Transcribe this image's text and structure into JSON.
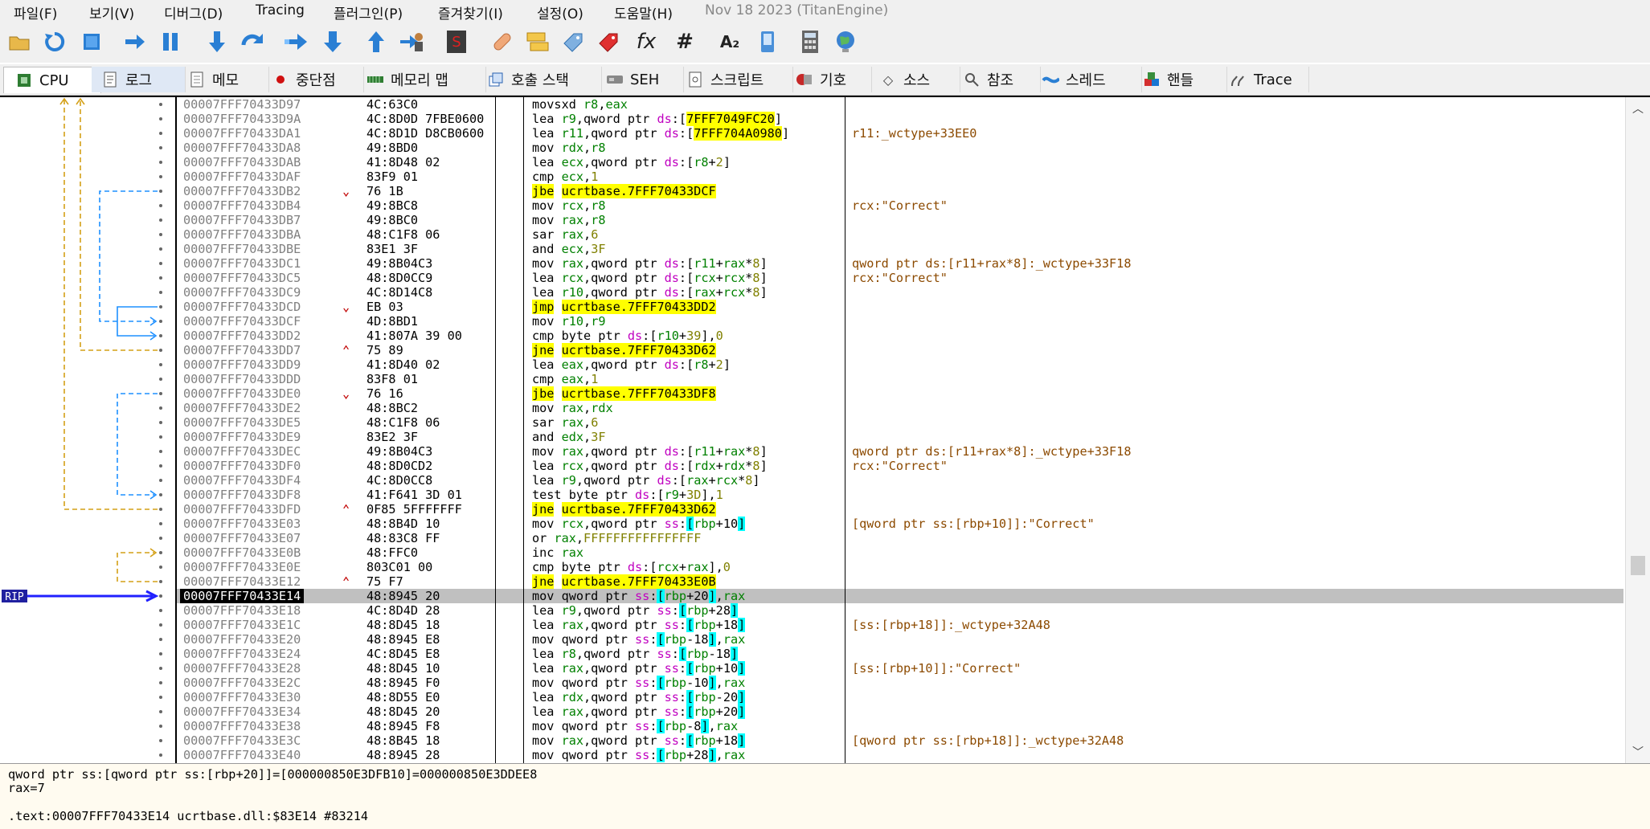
{
  "menu": [
    "파일(F)",
    "보기(V)",
    "디버그(D)",
    "Tracing",
    "플러그인(P)",
    "즐겨찾기(I)",
    "설정(O)",
    "도움말(H)"
  ],
  "build_label": "Nov 18 2023 (TitanEngine)",
  "toolbar": {
    "fx_label": "fx",
    "hash_label": "#",
    "az_label": "A₂"
  },
  "tabs": [
    {
      "label": "CPU",
      "icon": "cpu-icon"
    },
    {
      "label": "로그",
      "icon": "log-icon"
    },
    {
      "label": "메모",
      "icon": "notes-icon"
    },
    {
      "label": "중단점",
      "icon": "breakpoint-icon"
    },
    {
      "label": "메모리 맵",
      "icon": "memory-map-icon"
    },
    {
      "label": "호출 스택",
      "icon": "call-stack-icon"
    },
    {
      "label": "SEH",
      "icon": "seh-icon"
    },
    {
      "label": "스크립트",
      "icon": "script-icon"
    },
    {
      "label": "기호",
      "icon": "symbols-icon"
    },
    {
      "label": "소스",
      "icon": "source-icon"
    },
    {
      "label": "참조",
      "icon": "references-icon"
    },
    {
      "label": "스레드",
      "icon": "threads-icon"
    },
    {
      "label": "핸들",
      "icon": "handles-icon"
    },
    {
      "label": "Trace",
      "icon": "trace-icon"
    }
  ],
  "rip_label": "RIP",
  "disasm": [
    {
      "addr": "00007FFF70433D97",
      "arrow": "",
      "bytes": "4C:63C0",
      "asm": "movsxd r8,eax",
      "comment": ""
    },
    {
      "addr": "00007FFF70433D9A",
      "arrow": "",
      "bytes": "4C:8D0D 7FBE0600",
      "asm": "lea r9,qword ptr ds:[7FFF7049FC20]",
      "comment": ""
    },
    {
      "addr": "00007FFF70433DA1",
      "arrow": "",
      "bytes": "4C:8D1D D8CB0600",
      "asm": "lea r11,qword ptr ds:[7FFF704A0980]",
      "comment": "r11:_wctype+33EE0"
    },
    {
      "addr": "00007FFF70433DA8",
      "arrow": "",
      "bytes": "49:8BD0",
      "asm": "mov rdx,r8",
      "comment": ""
    },
    {
      "addr": "00007FFF70433DAB",
      "arrow": "",
      "bytes": "41:8D48 02",
      "asm": "lea ecx,qword ptr ds:[r8+2]",
      "comment": ""
    },
    {
      "addr": "00007FFF70433DAF",
      "arrow": "",
      "bytes": "83F9 01",
      "asm": "cmp ecx,1",
      "comment": ""
    },
    {
      "addr": "00007FFF70433DB2",
      "arrow": "v",
      "bytes": "76 1B",
      "asm": "jbe ucrtbase.7FFF70433DCF",
      "comment": ""
    },
    {
      "addr": "00007FFF70433DB4",
      "arrow": "",
      "bytes": "49:8BC8",
      "asm": "mov rcx,r8",
      "comment": "rcx:\"Correct\""
    },
    {
      "addr": "00007FFF70433DB7",
      "arrow": "",
      "bytes": "49:8BC0",
      "asm": "mov rax,r8",
      "comment": ""
    },
    {
      "addr": "00007FFF70433DBA",
      "arrow": "",
      "bytes": "48:C1F8 06",
      "asm": "sar rax,6",
      "comment": ""
    },
    {
      "addr": "00007FFF70433DBE",
      "arrow": "",
      "bytes": "83E1 3F",
      "asm": "and ecx,3F",
      "comment": ""
    },
    {
      "addr": "00007FFF70433DC1",
      "arrow": "",
      "bytes": "49:8B04C3",
      "asm": "mov rax,qword ptr ds:[r11+rax*8]",
      "comment": "qword ptr ds:[r11+rax*8]:_wctype+33F18"
    },
    {
      "addr": "00007FFF70433DC5",
      "arrow": "",
      "bytes": "48:8D0CC9",
      "asm": "lea rcx,qword ptr ds:[rcx+rcx*8]",
      "comment": "rcx:\"Correct\""
    },
    {
      "addr": "00007FFF70433DC9",
      "arrow": "",
      "bytes": "4C:8D14C8",
      "asm": "lea r10,qword ptr ds:[rax+rcx*8]",
      "comment": ""
    },
    {
      "addr": "00007FFF70433DCD",
      "arrow": "v",
      "bytes": "EB 03",
      "asm": "jmp ucrtbase.7FFF70433DD2",
      "comment": ""
    },
    {
      "addr": "00007FFF70433DCF",
      "arrow": "",
      "bytes": "4D:8BD1",
      "asm": "mov r10,r9",
      "comment": ""
    },
    {
      "addr": "00007FFF70433DD2",
      "arrow": "",
      "bytes": "41:807A 39 00",
      "asm": "cmp byte ptr ds:[r10+39],0",
      "comment": ""
    },
    {
      "addr": "00007FFF70433DD7",
      "arrow": "^",
      "bytes": "75 89",
      "asm": "jne ucrtbase.7FFF70433D62",
      "comment": ""
    },
    {
      "addr": "00007FFF70433DD9",
      "arrow": "",
      "bytes": "41:8D40 02",
      "asm": "lea eax,qword ptr ds:[r8+2]",
      "comment": ""
    },
    {
      "addr": "00007FFF70433DDD",
      "arrow": "",
      "bytes": "83F8 01",
      "asm": "cmp eax,1",
      "comment": ""
    },
    {
      "addr": "00007FFF70433DE0",
      "arrow": "v",
      "bytes": "76 16",
      "asm": "jbe ucrtbase.7FFF70433DF8",
      "comment": ""
    },
    {
      "addr": "00007FFF70433DE2",
      "arrow": "",
      "bytes": "48:8BC2",
      "asm": "mov rax,rdx",
      "comment": ""
    },
    {
      "addr": "00007FFF70433DE5",
      "arrow": "",
      "bytes": "48:C1F8 06",
      "asm": "sar rax,6",
      "comment": ""
    },
    {
      "addr": "00007FFF70433DE9",
      "arrow": "",
      "bytes": "83E2 3F",
      "asm": "and edx,3F",
      "comment": ""
    },
    {
      "addr": "00007FFF70433DEC",
      "arrow": "",
      "bytes": "49:8B04C3",
      "asm": "mov rax,qword ptr ds:[r11+rax*8]",
      "comment": "qword ptr ds:[r11+rax*8]:_wctype+33F18"
    },
    {
      "addr": "00007FFF70433DF0",
      "arrow": "",
      "bytes": "48:8D0CD2",
      "asm": "lea rcx,qword ptr ds:[rdx+rdx*8]",
      "comment": "rcx:\"Correct\""
    },
    {
      "addr": "00007FFF70433DF4",
      "arrow": "",
      "bytes": "4C:8D0CC8",
      "asm": "lea r9,qword ptr ds:[rax+rcx*8]",
      "comment": ""
    },
    {
      "addr": "00007FFF70433DF8",
      "arrow": "",
      "bytes": "41:F641 3D 01",
      "asm": "test byte ptr ds:[r9+3D],1",
      "comment": ""
    },
    {
      "addr": "00007FFF70433DFD",
      "arrow": "^",
      "bytes": "0F85 5FFFFFFF",
      "asm": "jne ucrtbase.7FFF70433D62",
      "comment": ""
    },
    {
      "addr": "00007FFF70433E03",
      "arrow": "",
      "bytes": "48:8B4D 10",
      "asm": "mov rcx,qword ptr ss:[rbp+10]",
      "comment": "[qword ptr ss:[rbp+10]]:\"Correct\""
    },
    {
      "addr": "00007FFF70433E07",
      "arrow": "",
      "bytes": "48:83C8 FF",
      "asm": "or rax,FFFFFFFFFFFFFFFF",
      "comment": ""
    },
    {
      "addr": "00007FFF70433E0B",
      "arrow": "",
      "bytes": "48:FFC0",
      "asm": "inc rax",
      "comment": ""
    },
    {
      "addr": "00007FFF70433E0E",
      "arrow": "",
      "bytes": "803C01 00",
      "asm": "cmp byte ptr ds:[rcx+rax],0",
      "comment": ""
    },
    {
      "addr": "00007FFF70433E12",
      "arrow": "^",
      "bytes": "75 F7",
      "asm": "jne ucrtbase.7FFF70433E0B",
      "comment": ""
    },
    {
      "addr": "00007FFF70433E14",
      "arrow": "",
      "bytes": "48:8945 20",
      "asm": "mov qword ptr ss:[rbp+20],rax",
      "comment": ""
    },
    {
      "addr": "00007FFF70433E18",
      "arrow": "",
      "bytes": "4C:8D4D 28",
      "asm": "lea r9,qword ptr ss:[rbp+28]",
      "comment": ""
    },
    {
      "addr": "00007FFF70433E1C",
      "arrow": "",
      "bytes": "48:8D45 18",
      "asm": "lea rax,qword ptr ss:[rbp+18]",
      "comment": "[ss:[rbp+18]]:_wctype+32A48"
    },
    {
      "addr": "00007FFF70433E20",
      "arrow": "",
      "bytes": "48:8945 E8",
      "asm": "mov qword ptr ss:[rbp-18],rax",
      "comment": ""
    },
    {
      "addr": "00007FFF70433E24",
      "arrow": "",
      "bytes": "4C:8D45 E8",
      "asm": "lea r8,qword ptr ss:[rbp-18]",
      "comment": ""
    },
    {
      "addr": "00007FFF70433E28",
      "arrow": "",
      "bytes": "48:8D45 10",
      "asm": "lea rax,qword ptr ss:[rbp+10]",
      "comment": "[ss:[rbp+10]]:\"Correct\""
    },
    {
      "addr": "00007FFF70433E2C",
      "arrow": "",
      "bytes": "48:8945 F0",
      "asm": "mov qword ptr ss:[rbp-10],rax",
      "comment": ""
    },
    {
      "addr": "00007FFF70433E30",
      "arrow": "",
      "bytes": "48:8D55 E0",
      "asm": "lea rdx,qword ptr ss:[rbp-20]",
      "comment": ""
    },
    {
      "addr": "00007FFF70433E34",
      "arrow": "",
      "bytes": "48:8D45 20",
      "asm": "lea rax,qword ptr ss:[rbp+20]",
      "comment": ""
    },
    {
      "addr": "00007FFF70433E38",
      "arrow": "",
      "bytes": "48:8945 F8",
      "asm": "mov qword ptr ss:[rbp-8],rax",
      "comment": ""
    },
    {
      "addr": "00007FFF70433E3C",
      "arrow": "",
      "bytes": "48:8B45 18",
      "asm": "mov rax,qword ptr ss:[rbp+18]",
      "comment": "[qword ptr ss:[rbp+18]]:_wctype+32A48"
    },
    {
      "addr": "00007FFF70433E40",
      "arrow": "",
      "bytes": "48:8945 28",
      "asm": "mov qword ptr ss:[rbp+28],rax",
      "comment": ""
    }
  ],
  "current_index": 34,
  "info_lines": [
    "qword ptr ss:[qword ptr ss:[rbp+20]]=[000000850E3DFB10]=000000850E3DDEE8",
    "rax=7",
    "",
    ".text:00007FFF70433E14 ucrtbase.dll:$83E14 #83214"
  ],
  "colors": {
    "jump_line": "#d4a017",
    "jump_line_alt": "#1e90ff",
    "rip_arrow": "#2020ff",
    "highlight": "#ffff00",
    "mem_highlight": "#00ffff",
    "comment": "#8c4a00"
  }
}
